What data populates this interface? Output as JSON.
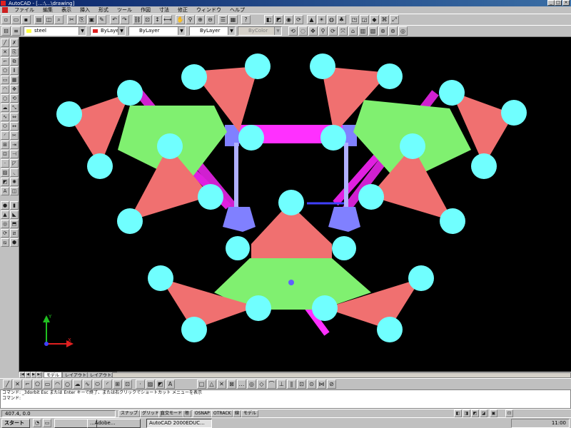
{
  "window": {
    "title": "AutoCAD - [...:\\...\\drawing]",
    "minimize": "_",
    "maximize": "□",
    "close": "×"
  },
  "menu": [
    "ファイル",
    "編集",
    "表示",
    "挿入",
    "形式",
    "ツール",
    "作図",
    "寸法",
    "修正",
    "ウィンドウ",
    "ヘルプ"
  ],
  "props": {
    "layer_value": "steel",
    "color_value": "ByLayer",
    "linetype_value": "ByLayer",
    "lineweight_value": "ByLayer",
    "plotstyle_value": "ByColor"
  },
  "tabs": [
    "モデル",
    "レイアウト1",
    "レイアウト2"
  ],
  "command_lines": [
    "コマンド: _3dorbit Esc または Enter キーで終了、または右クリックでショートカット メニューを表示",
    "コマンド:"
  ],
  "status": {
    "coords": "407.4, 0.0",
    "modes": [
      "スナップ",
      "グリッド",
      "直交モード",
      "極",
      "OSNAP",
      "OTRACK",
      "線",
      "モデル"
    ]
  },
  "taskbar": {
    "start": "スタート",
    "tasks": [
      "",
      "...Adobe...",
      "AutoCAD 2000EDUC..."
    ],
    "clock": "11:00"
  },
  "colors": {
    "canvas": "#000000",
    "salmon": "#f07070",
    "green": "#80f070",
    "cyan": "#70ffff",
    "magenta": "#ff20ff",
    "lavender": "#a0a0ff",
    "titlebar": "#0a246a"
  },
  "icons": {
    "ucs": "ucs-axis-icon"
  }
}
